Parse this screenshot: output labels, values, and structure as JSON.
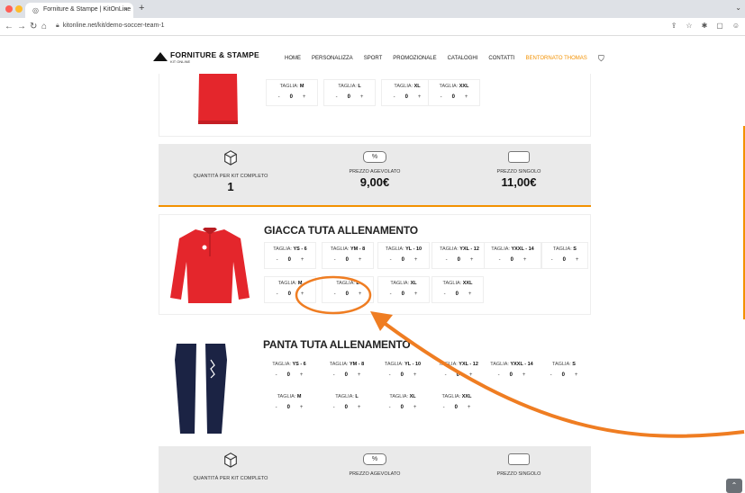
{
  "browser": {
    "tab_title": "Forniture & Stampe | KitOnLine",
    "url": "kitonline.net/kit/demo-soccer-team-1"
  },
  "site": {
    "logo_title": "FORNITURE & STAMPE",
    "logo_sub": "KIT ONLINE",
    "nav": [
      "HOME",
      "PERSONALIZZA",
      "SPORT",
      "PROMOZIONALE",
      "CATALOGHI",
      "CONTATTI",
      "BENTORNATO THOMAS"
    ]
  },
  "top_product": {
    "sizes": [
      {
        "prefix": "TAGLIA:",
        "size": "M",
        "qty": "0"
      },
      {
        "prefix": "TAGLIA:",
        "size": "L",
        "qty": "0"
      },
      {
        "prefix": "TAGLIA:",
        "size": "XL",
        "qty": "0"
      },
      {
        "prefix": "TAGLIA:",
        "size": "XXL",
        "qty": "0"
      }
    ]
  },
  "strip": {
    "qty_label": "QUANTITÀ PER KIT COMPLETO",
    "qty_value": "1",
    "discount_label": "PREZZO AGEVOLATO",
    "discount_value": "9,00€",
    "single_label": "PREZZO SINGOLO",
    "single_value": "11,00€",
    "percent": "%"
  },
  "product1": {
    "title": "GIACCA TUTA ALLENAMENTO",
    "sizes": [
      {
        "prefix": "TAGLIA:",
        "size": "YS - 6",
        "qty": "0"
      },
      {
        "prefix": "TAGLIA:",
        "size": "YM - 8",
        "qty": "0"
      },
      {
        "prefix": "TAGLIA:",
        "size": "YL - 10",
        "qty": "0"
      },
      {
        "prefix": "TAGLIA:",
        "size": "YXL - 12",
        "qty": "0"
      },
      {
        "prefix": "TAGLIA:",
        "size": "YXXL - 14",
        "qty": "0"
      },
      {
        "prefix": "TAGLIA:",
        "size": "S",
        "qty": "0"
      },
      {
        "prefix": "TAGLIA:",
        "size": "M",
        "qty": "0"
      },
      {
        "prefix": "TAGLIA:",
        "size": "L",
        "qty": "0"
      },
      {
        "prefix": "TAGLIA:",
        "size": "XL",
        "qty": "0"
      },
      {
        "prefix": "TAGLIA:",
        "size": "XXL",
        "qty": "0"
      }
    ]
  },
  "product2": {
    "title": "PANTA TUTA ALLENAMENTO",
    "sizes": [
      {
        "prefix": "TAGLIA:",
        "size": "YS - 6",
        "qty": "0"
      },
      {
        "prefix": "TAGLIA:",
        "size": "YM - 8",
        "qty": "0"
      },
      {
        "prefix": "TAGLIA:",
        "size": "YL - 10",
        "qty": "0"
      },
      {
        "prefix": "TAGLIA:",
        "size": "YXL - 12",
        "qty": "0"
      },
      {
        "prefix": "TAGLIA:",
        "size": "YXXL - 14",
        "qty": "0"
      },
      {
        "prefix": "TAGLIA:",
        "size": "S",
        "qty": "0"
      },
      {
        "prefix": "TAGLIA:",
        "size": "M",
        "qty": "0"
      },
      {
        "prefix": "TAGLIA:",
        "size": "L",
        "qty": "0"
      },
      {
        "prefix": "TAGLIA:",
        "size": "XL",
        "qty": "0"
      },
      {
        "prefix": "TAGLIA:",
        "size": "XXL",
        "qty": "0"
      }
    ]
  },
  "strip2": {
    "qty_label": "QUANTITÀ PER KIT COMPLETO",
    "discount_label": "PREZZO AGEVOLATO",
    "single_label": "PREZZO SINGOLO",
    "percent": "%"
  },
  "qty_controls": {
    "minus": "-",
    "plus": "+"
  },
  "colors": {
    "accent": "#f39100",
    "annotation": "#ef7d22",
    "jacket": "#e4262c",
    "pants": "#1b2344"
  }
}
